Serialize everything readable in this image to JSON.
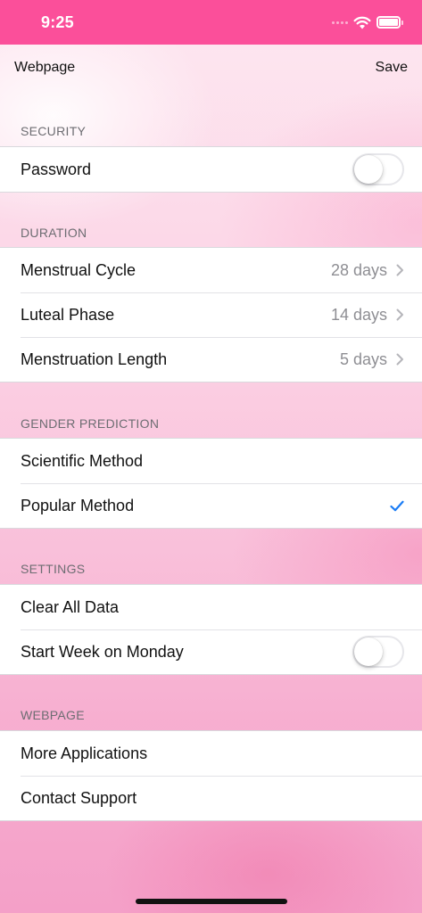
{
  "status_bar": {
    "time": "9:25"
  },
  "nav": {
    "left": "Webpage",
    "right": "Save"
  },
  "sections": {
    "security": {
      "header": "SECURITY",
      "rows": [
        {
          "label": "Password",
          "toggle_on": false
        }
      ]
    },
    "duration": {
      "header": "DURATION",
      "rows": [
        {
          "label": "Menstrual Cycle",
          "value": "28 days"
        },
        {
          "label": "Luteal Phase",
          "value": "14 days"
        },
        {
          "label": "Menstruation Length",
          "value": "5 days"
        }
      ]
    },
    "gender_prediction": {
      "header": "GENDER PREDICTION",
      "rows": [
        {
          "label": "Scientific Method",
          "selected": false
        },
        {
          "label": "Popular Method",
          "selected": true
        }
      ]
    },
    "settings": {
      "header": "SETTINGS",
      "rows": [
        {
          "label": "Clear All Data"
        },
        {
          "label": "Start Week on Monday",
          "toggle_on": false
        }
      ]
    },
    "webpage": {
      "header": "WEBPAGE",
      "rows": [
        {
          "label": "More Applications"
        },
        {
          "label": "Contact Support"
        }
      ]
    }
  },
  "colors": {
    "status_bar": "#fb4f9a",
    "checkmark": "#1a7cf5",
    "secondary_text": "#8e8e93",
    "section_header": "#6d6d72"
  },
  "icons": {
    "wifi": "wifi-icon",
    "battery": "battery-icon",
    "cellular": "cellular-signal-icon",
    "chevron": "chevron-right-icon",
    "check": "checkmark-icon"
  }
}
